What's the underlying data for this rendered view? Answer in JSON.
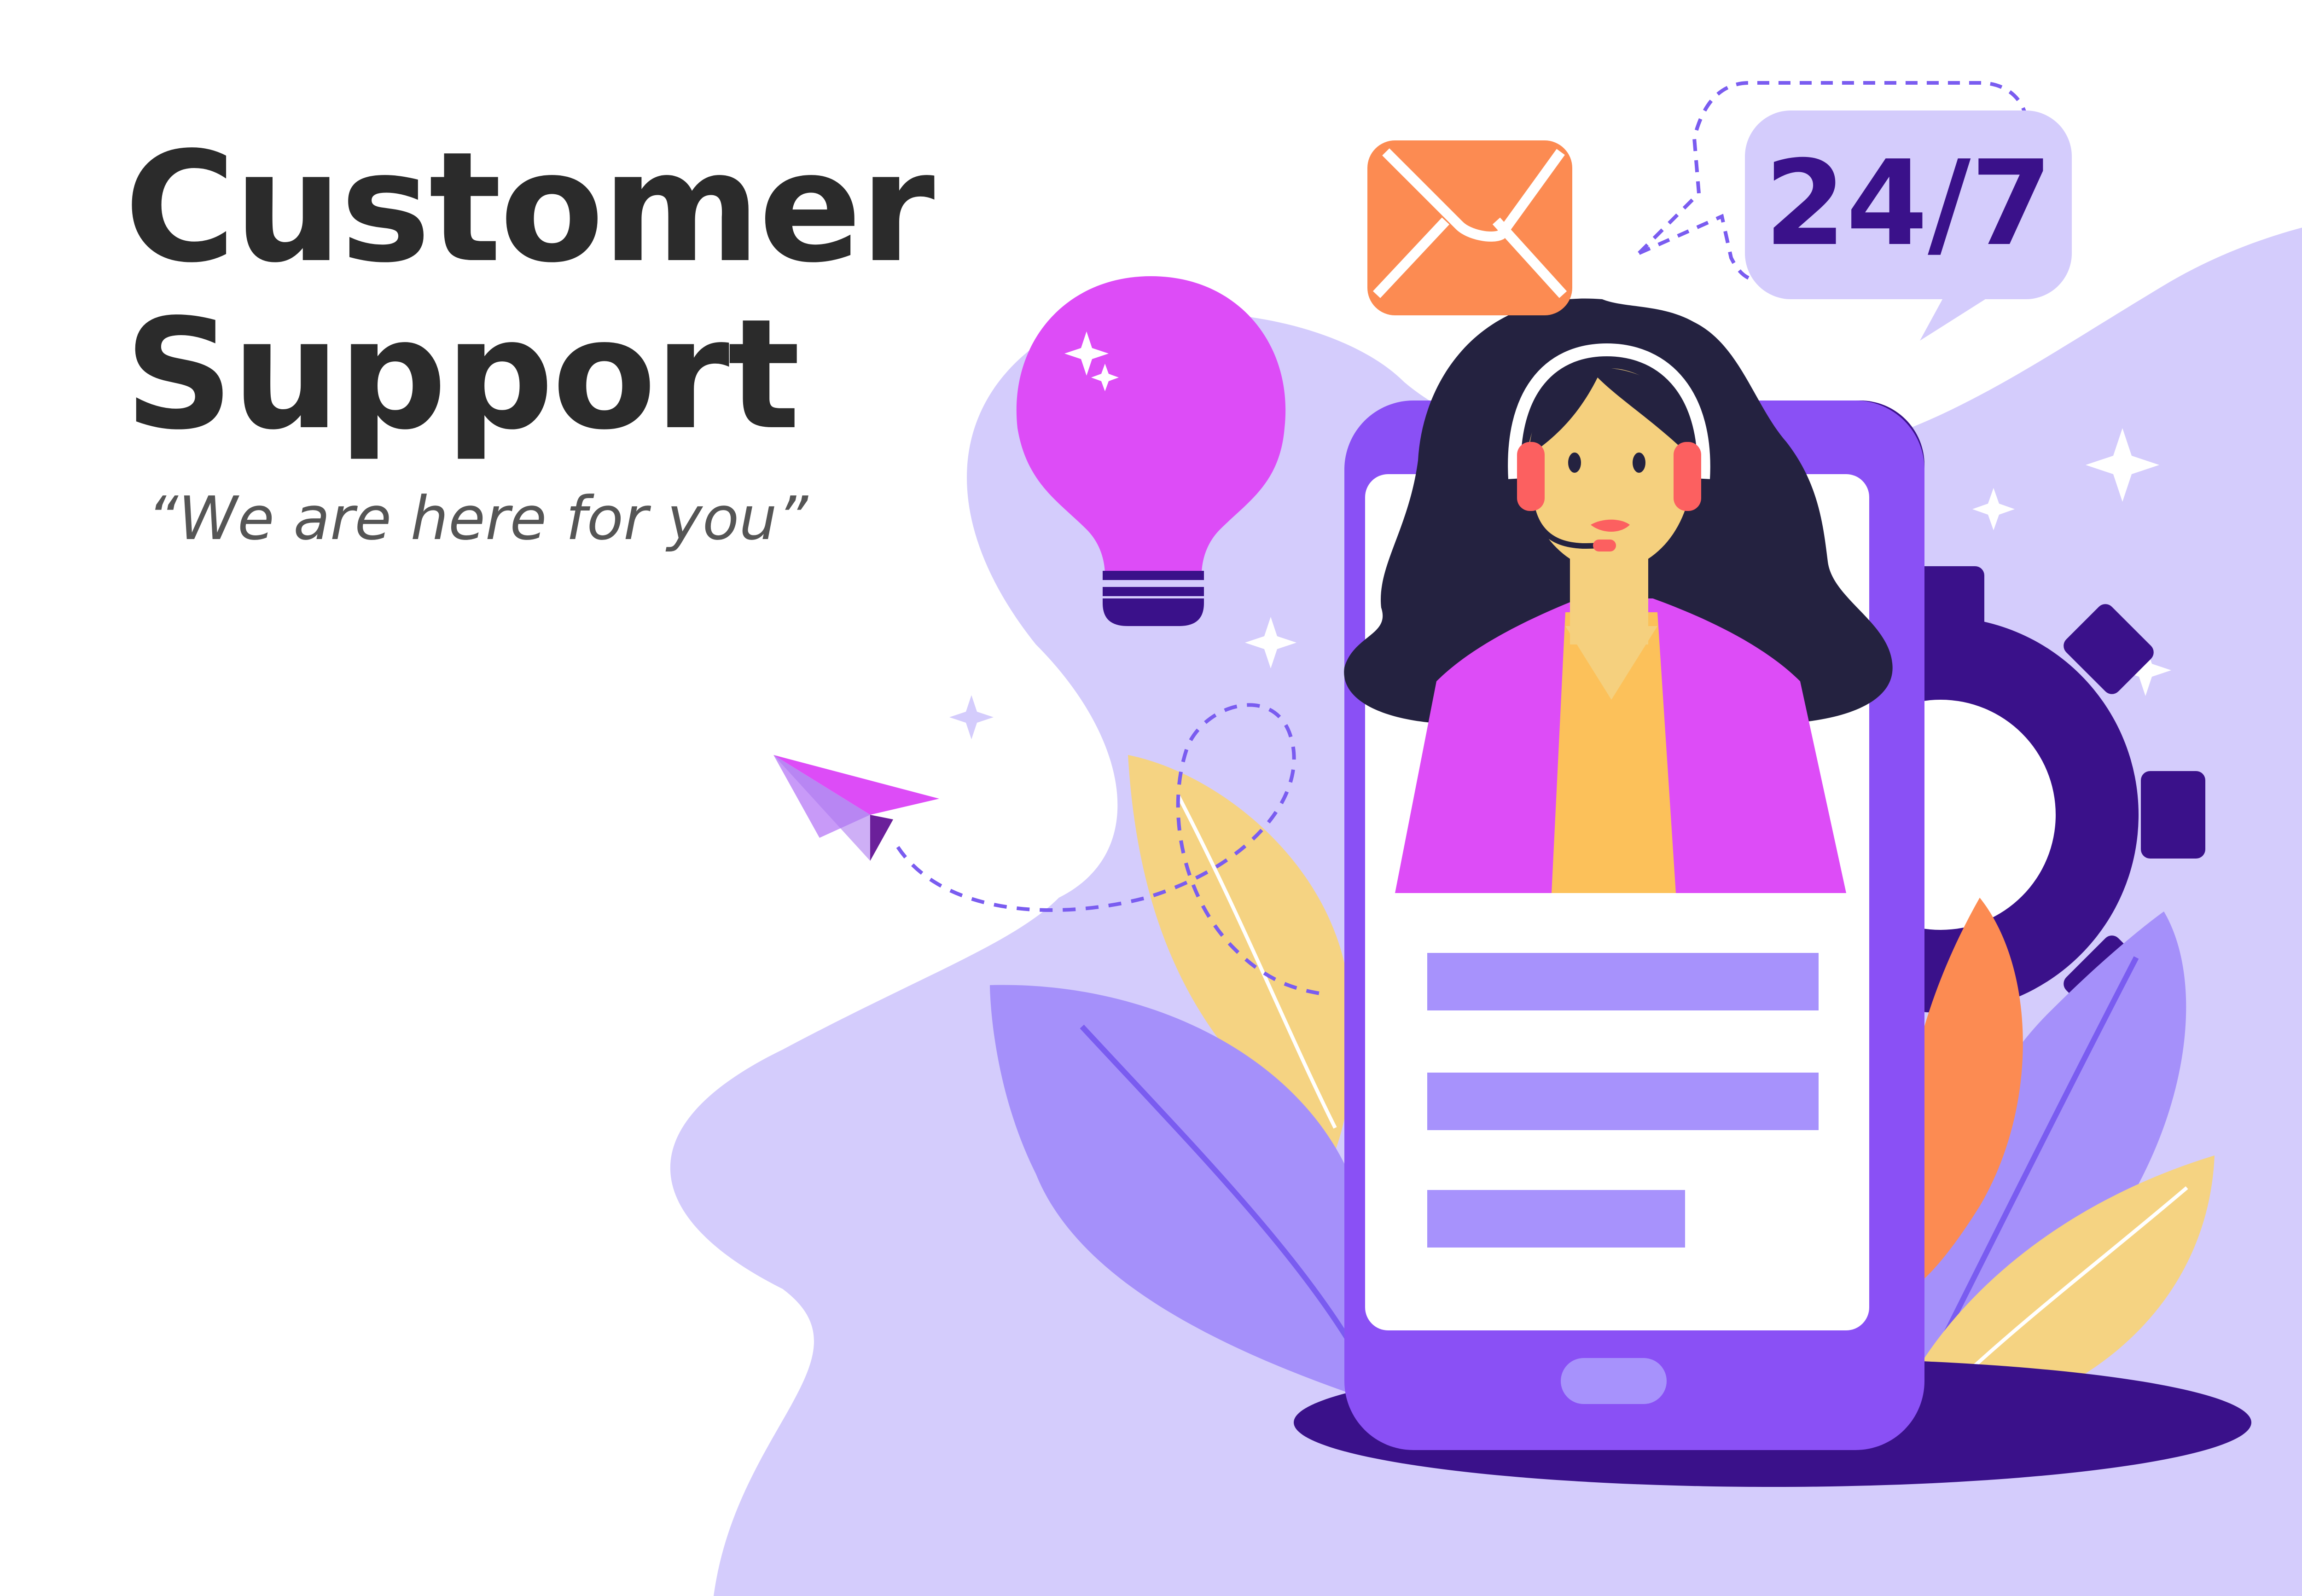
{
  "heading": {
    "line1": "Customer",
    "line2": "Support"
  },
  "tagline": "“We are here for you”",
  "badge": {
    "text": "24/7"
  },
  "colors": {
    "background_blob": "#d4ccfc",
    "phone": "#8a50f5",
    "phone_dark": "#3a118a",
    "phone_button": "#a792fc",
    "form_bar": "#a792fc",
    "bulb": "#dd4cf7",
    "envelope": "#fc8b52",
    "leaf_yellow": "#f5d382",
    "leaf_purple": "#a590fa",
    "leaf_orange": "#fc8b52",
    "hair": "#242240",
    "skin": "#f5d07e",
    "jacket": "#dd4cf7",
    "shirt": "#fcc15a",
    "headset": "#fc6060",
    "heading_text": "#2b2b2b",
    "badge_bg": "#d4ccfc",
    "badge_text": "#3a118a"
  },
  "icons": {
    "bulb": "lightbulb-icon",
    "envelope": "envelope-icon",
    "plane": "paper-plane-icon",
    "gear": "gear-icon",
    "chat": "speech-bubble-icon"
  }
}
